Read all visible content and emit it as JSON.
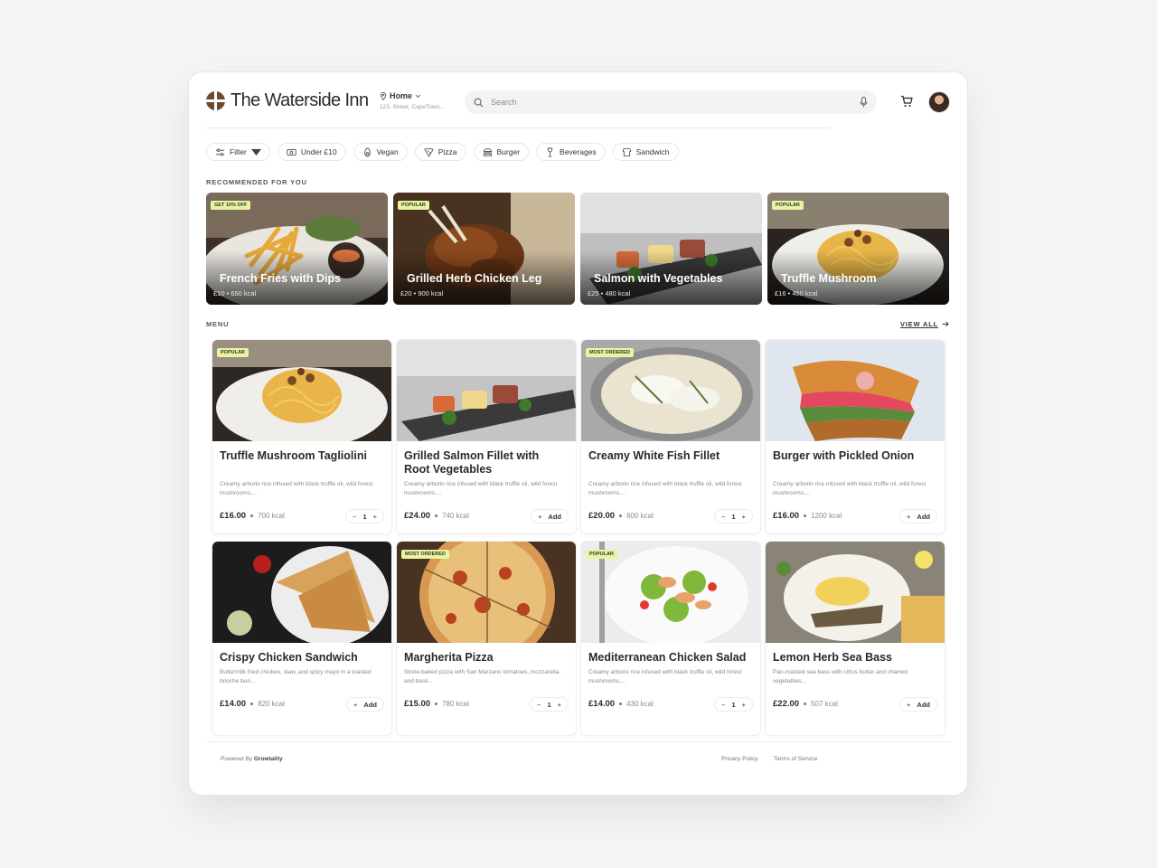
{
  "header": {
    "brand": "The Waterside Inn",
    "location_label": "Home",
    "location_address": "123, Street, CapeTown...",
    "search_placeholder": "Search"
  },
  "filters": [
    "Filter",
    "Under £10",
    "Vegan",
    "Pizza",
    "Burger",
    "Beverages",
    "Sandwich"
  ],
  "recommended": {
    "label": "RECOMMENDED FOR YOU",
    "items": [
      {
        "title": "French Fries with Dips",
        "price": "£10",
        "kcal": "650 kcal",
        "badge": "GET 10% OFF"
      },
      {
        "title": "Grilled Herb Chicken Leg",
        "price": "£20",
        "kcal": "900 kcal",
        "badge": "POPULAR"
      },
      {
        "title": "Salmon with Vegetables",
        "price": "£25",
        "kcal": "480 kcal",
        "badge": ""
      },
      {
        "title": "Truffle Mushroom",
        "price": "£16",
        "kcal": "450 kcal",
        "badge": "POPULAR"
      }
    ]
  },
  "menu": {
    "label": "MENU",
    "view_all": "VIEW ALL",
    "items": [
      {
        "title": "Truffle Mushroom Tagliolini",
        "desc": "Creamy arborio rice infused with black truffle oil, wild forest mushrooms....",
        "price": "£16.00",
        "kcal": "700 kcal",
        "badge": "POPULAR",
        "qty": "1"
      },
      {
        "title": "Grilled Salmon Fillet with Root Vegetables",
        "desc": "Creamy arborio rice infused with black truffle oil, wild forest mushrooms....",
        "price": "£24.00",
        "kcal": "740 kcal",
        "badge": "",
        "add": "Add"
      },
      {
        "title": "Creamy White Fish Fillet",
        "desc": "Creamy arborio rice infused with black truffle oil, wild forest mushrooms....",
        "price": "£20.00",
        "kcal": "600 kcal",
        "badge": "MOST ORDERED",
        "qty": "1"
      },
      {
        "title": "Burger with Pickled Onion",
        "desc": "Creamy arborio rice infused with black truffle oil, wild forest mushrooms....",
        "price": "£16.00",
        "kcal": "1200 kcal",
        "badge": "",
        "add": "Add"
      },
      {
        "title": "Crispy Chicken Sandwich",
        "desc": "Buttermilk fried chicken, slaw, and spicy mayo in a toasted brioche bun...",
        "price": "£14.00",
        "kcal": "820 kcal",
        "badge": "",
        "add": "Add"
      },
      {
        "title": "Margherita Pizza",
        "desc": "Stone-baked pizza with San Marzano tomatoes, mozzarella, and basil...",
        "price": "£15.00",
        "kcal": "780 kcal",
        "badge": "MOST ORDERED",
        "qty": "1"
      },
      {
        "title": "Mediterranean Chicken Salad",
        "desc": "Creamy arborio rice infused with black truffle oil, wild forest mushrooms....",
        "price": "£14.00",
        "kcal": "430 kcal",
        "badge": "POPULAR",
        "qty": "1"
      },
      {
        "title": "Lemon Herb Sea Bass",
        "desc": "Pan-roasted sea bass with citrus butter and charred vegetables...",
        "price": "£22.00",
        "kcal": "507 kcal",
        "badge": "",
        "add": "Add"
      }
    ]
  },
  "footer": {
    "powered_prefix": "Powered By",
    "powered_brand": "Growtality",
    "privacy": "Privacy Policy",
    "terms": "Terms of Service"
  },
  "colors": {
    "badge": "#e8f5a0",
    "brand_logo": "#6b4a2e"
  }
}
